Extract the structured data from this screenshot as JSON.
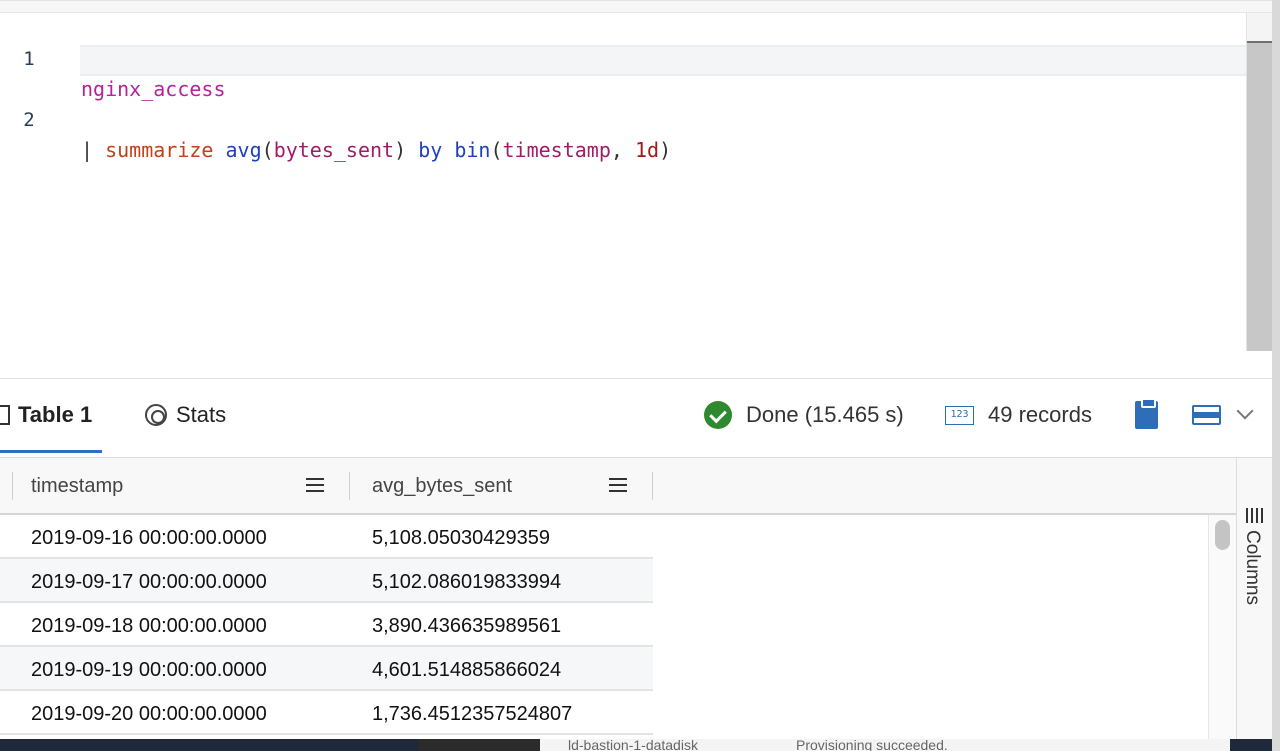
{
  "editor": {
    "lines": [
      {
        "number": "1",
        "tokens": {
          "table": "nginx_access"
        }
      },
      {
        "number": "2",
        "tokens": {
          "pipe": "| ",
          "summarize": "summarize",
          "sp1": " ",
          "avg": "avg",
          "lp1": "(",
          "col1": "bytes_sent",
          "rp1": ")",
          "sp2": " ",
          "by": "by",
          "sp3": " ",
          "bin": "bin",
          "lp2": "(",
          "col2": "timestamp",
          "comma": ", ",
          "num": "1d",
          "rp2": ")"
        }
      }
    ]
  },
  "results": {
    "tabs": [
      {
        "label": "Table 1",
        "icon": "table-icon",
        "active": true
      },
      {
        "label": "Stats",
        "icon": "stats-icon",
        "active": false
      }
    ],
    "status": "Done (15.465 s)",
    "status_color": "#2f8a2f",
    "records": "49 records",
    "records_icon": "123",
    "accent_color": "#2f6db8"
  },
  "grid": {
    "columns": [
      "timestamp",
      "avg_bytes_sent"
    ],
    "rows": [
      [
        "2019-09-16 00:00:00.0000",
        "5,108.05030429359"
      ],
      [
        "2019-09-17 00:00:00.0000",
        "5,102.086019833994"
      ],
      [
        "2019-09-18 00:00:00.0000",
        "3,890.436635989561"
      ],
      [
        "2019-09-19 00:00:00.0000",
        "4,601.514885866024"
      ],
      [
        "2019-09-20 00:00:00.0000",
        "1,736.4512357524807"
      ]
    ],
    "side_panel_label": "Columns"
  },
  "background_strip": {
    "text_left": "ld-bastion-1-datadisk",
    "text_right": "Provisioning succeeded."
  }
}
